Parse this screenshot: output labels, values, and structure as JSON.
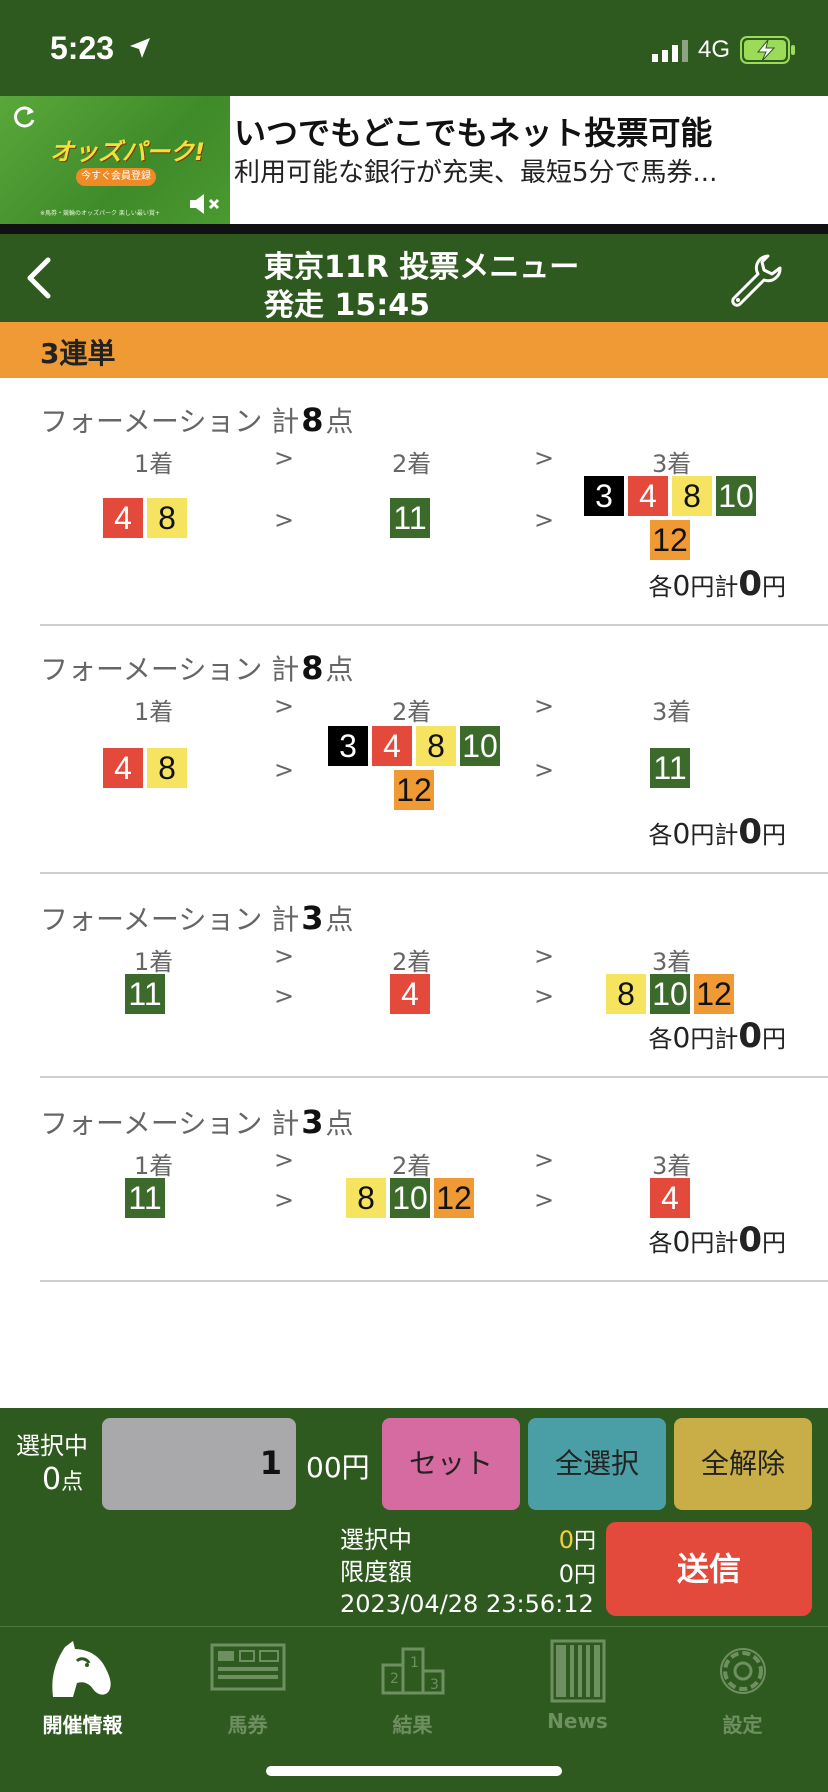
{
  "status_bar": {
    "time": "5:23",
    "network": "4G"
  },
  "ad": {
    "logo": "オッズパーク!",
    "pill": "今すぐ会員登録",
    "fine_print": "※馬券・競輪のオッズパーク 楽しい最い賞+",
    "headline": "いつでもどこでもネット投票可能",
    "subtext": "利用可能な銀行が充実、最短5分で馬券..."
  },
  "header": {
    "title": "東京11R 投票メニュー",
    "subtitle": "発走 15:45"
  },
  "bet_type": "3連単",
  "formations": [
    {
      "label": "フォーメーション 計",
      "count": "8",
      "unit": "点",
      "col1": "1着",
      "col2": "2着",
      "col3": "3着",
      "arrow": ">",
      "first": [
        {
          "num": "4",
          "color": "red"
        },
        {
          "num": "8",
          "color": "yellow"
        }
      ],
      "second": [
        {
          "num": "11",
          "color": "green"
        }
      ],
      "third": [
        {
          "num": "3",
          "color": "black"
        },
        {
          "num": "4",
          "color": "red"
        },
        {
          "num": "8",
          "color": "yellow"
        },
        {
          "num": "10",
          "color": "green"
        },
        {
          "num": "12",
          "color": "orange"
        }
      ],
      "each_label": "各",
      "each_value": "0",
      "yen": "円",
      "total_label": "計",
      "total_value": "0"
    },
    {
      "label": "フォーメーション 計",
      "count": "8",
      "unit": "点",
      "col1": "1着",
      "col2": "2着",
      "col3": "3着",
      "arrow": ">",
      "first": [
        {
          "num": "4",
          "color": "red"
        },
        {
          "num": "8",
          "color": "yellow"
        }
      ],
      "second": [
        {
          "num": "3",
          "color": "black"
        },
        {
          "num": "4",
          "color": "red"
        },
        {
          "num": "8",
          "color": "yellow"
        },
        {
          "num": "10",
          "color": "green"
        },
        {
          "num": "12",
          "color": "orange"
        }
      ],
      "third": [
        {
          "num": "11",
          "color": "green"
        }
      ],
      "each_label": "各",
      "each_value": "0",
      "yen": "円",
      "total_label": "計",
      "total_value": "0"
    },
    {
      "label": "フォーメーション 計",
      "count": "3",
      "unit": "点",
      "col1": "1着",
      "col2": "2着",
      "col3": "3着",
      "arrow": ">",
      "first": [
        {
          "num": "11",
          "color": "green"
        }
      ],
      "second": [
        {
          "num": "4",
          "color": "red"
        }
      ],
      "third": [
        {
          "num": "8",
          "color": "yellow"
        },
        {
          "num": "10",
          "color": "green"
        },
        {
          "num": "12",
          "color": "orange"
        }
      ],
      "each_label": "各",
      "each_value": "0",
      "yen": "円",
      "total_label": "計",
      "total_value": "0"
    },
    {
      "label": "フォーメーション 計",
      "count": "3",
      "unit": "点",
      "col1": "1着",
      "col2": "2着",
      "col3": "3着",
      "arrow": ">",
      "first": [
        {
          "num": "11",
          "color": "green"
        }
      ],
      "second": [
        {
          "num": "8",
          "color": "yellow"
        },
        {
          "num": "10",
          "color": "green"
        },
        {
          "num": "12",
          "color": "orange"
        }
      ],
      "third": [
        {
          "num": "4",
          "color": "red"
        }
      ],
      "each_label": "各",
      "each_value": "0",
      "yen": "円",
      "total_label": "計",
      "total_value": "0"
    }
  ],
  "panel": {
    "selected_label": "選択中",
    "selected_count": "0",
    "selected_unit": "点",
    "amount_value": "1",
    "amount_unit": "00円",
    "set_button": "セット",
    "select_all_button": "全選択",
    "clear_all_button": "全解除",
    "sel_line_label": "選択中",
    "sel_line_value": "0",
    "limit_label": "限度額",
    "limit_value": "0",
    "yen": "円",
    "datetime": "2023/04/28 23:56:12",
    "send_button": "送信"
  },
  "tabs": [
    {
      "label": "開催情報",
      "icon": "horse-head-icon",
      "active": true
    },
    {
      "label": "馬券",
      "icon": "ticket-icon",
      "active": false
    },
    {
      "label": "結果",
      "icon": "podium-icon",
      "active": false
    },
    {
      "label": "News",
      "icon": "newspaper-icon",
      "active": false
    },
    {
      "label": "設定",
      "icon": "gear-icon",
      "active": false
    }
  ],
  "colors": {
    "header_green": "#2f5a1f",
    "accent_orange": "#ef9a34",
    "send_red": "#e44a3b",
    "horse_colors": {
      "black": "#000000",
      "red": "#e44a3b",
      "yellow": "#f6e461",
      "green": "#3b6a2a",
      "orange": "#ef9a34"
    }
  }
}
